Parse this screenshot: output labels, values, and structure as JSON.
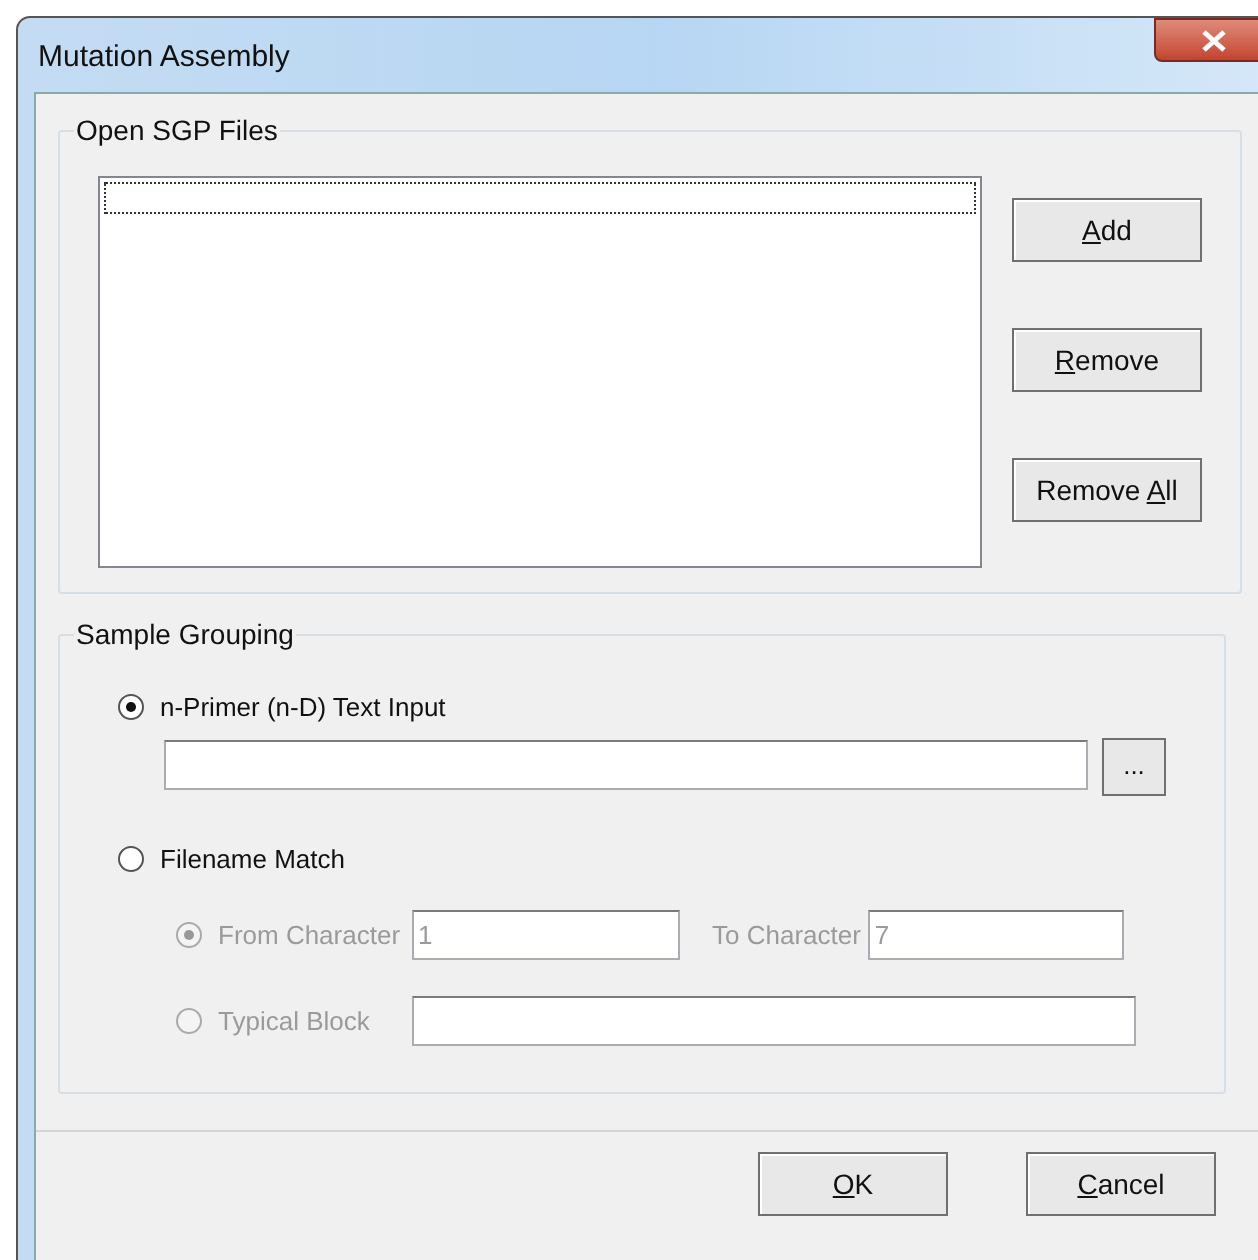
{
  "window": {
    "title": "Mutation Assembly"
  },
  "files_group": {
    "title": "Open SGP Files",
    "buttons": [
      {
        "key": "A",
        "after": "dd"
      },
      {
        "key": "R",
        "after": "emove"
      },
      {
        "before": "Remove ",
        "key": "A",
        "after": "ll"
      }
    ]
  },
  "grouping": {
    "title": "Sample Grouping",
    "options": [
      {
        "label": "n-Primer (n-D) Text Input",
        "selected": true
      },
      {
        "label": "Filename Match",
        "selected": false
      }
    ],
    "primer_field": {
      "browse": "..."
    },
    "sub_options": [
      {
        "label": "From Character",
        "selected": true,
        "disabled": true
      },
      {
        "label": "Typical Block",
        "selected": false,
        "disabled": true
      }
    ],
    "from_value": "1",
    "to_label": "To Character",
    "to_value": "7"
  },
  "buttons": [
    {
      "key": "O",
      "after": "K"
    },
    {
      "key": "C",
      "after": "ancel"
    }
  ]
}
